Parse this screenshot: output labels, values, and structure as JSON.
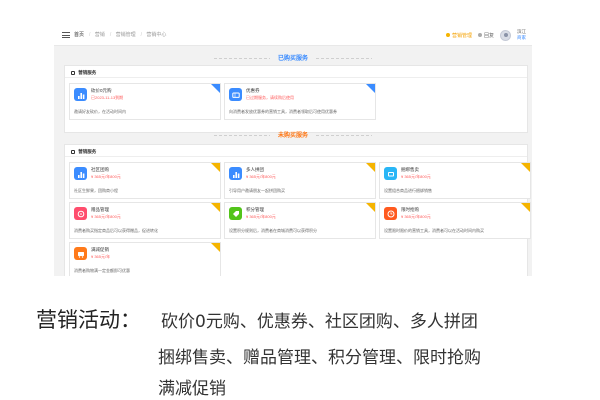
{
  "breadcrumb": {
    "home": "首页",
    "items": [
      "营销",
      "营销管理",
      "营销中心"
    ]
  },
  "topbar_right": {
    "link1": "营销管理",
    "link2": "回复",
    "user_name": "滨江",
    "user_role": "商家"
  },
  "sections": {
    "bought_title": "已购买服务",
    "notbought_title": "未购买服务"
  },
  "panel_label": "营销服务",
  "bought_cards": [
    {
      "name": "砍价0元购",
      "status": "已2023-11-13到期",
      "desc": "邀请好友砍价，在活动时间内",
      "icon": "chart-icon",
      "color": "#3b8cff"
    },
    {
      "name": "优惠券",
      "status": "已过期服务，请续购后使用",
      "desc": "向消费者发放优惠券的营销工具，消费者领取后可使用优惠券",
      "icon": "coupon-icon",
      "color": "#3b8cff"
    }
  ],
  "notbought_cards": [
    {
      "name": "社区团购",
      "status": "¥ 365元/年800元",
      "desc": "社区生鲜果，团购商小程",
      "icon": "chart-icon",
      "color": "#3b8cff"
    },
    {
      "name": "多人拼团",
      "status": "¥ 365元/年800元",
      "desc": "引导用户邀请朋友一起拼团购买",
      "icon": "chart-icon",
      "color": "#3b8cff"
    },
    {
      "name": "捆绑售卖",
      "status": "¥ 365元/年800元",
      "desc": "设置组合商品进行捆绑销售",
      "icon": "bundle-icon",
      "color": "#29b6f6"
    },
    {
      "name": "赠品管理",
      "status": "¥ 365元/年800元",
      "desc": "消费者购买指定商品后可以获得赠品，促进转化",
      "icon": "gift-icon",
      "color": "#ff4d6d"
    },
    {
      "name": "积分管理",
      "status": "¥ 365元/年800元",
      "desc": "设置积分规则后，消费者在商城消费可以获得积分",
      "icon": "points-icon",
      "color": "#52c41a"
    },
    {
      "name": "限时抢购",
      "status": "¥ 365元/年800元",
      "desc": "设置限时限价的营销工具，消费者可以在活动时间内购买",
      "icon": "clock-icon",
      "color": "#ff5a1f"
    },
    {
      "name": "满减促销",
      "status": "¥ 365元/年",
      "desc": "消费者购物满一定金额即可优惠",
      "icon": "cart-icon",
      "color": "#ff7a1a"
    }
  ],
  "caption": {
    "label": "营销活动：",
    "line1": "砍价0元购、优惠券、社区团购、多人拼团",
    "line2": "捆绑售卖、赠品管理、积分管理、限时抢购",
    "line3": "满减促销"
  }
}
